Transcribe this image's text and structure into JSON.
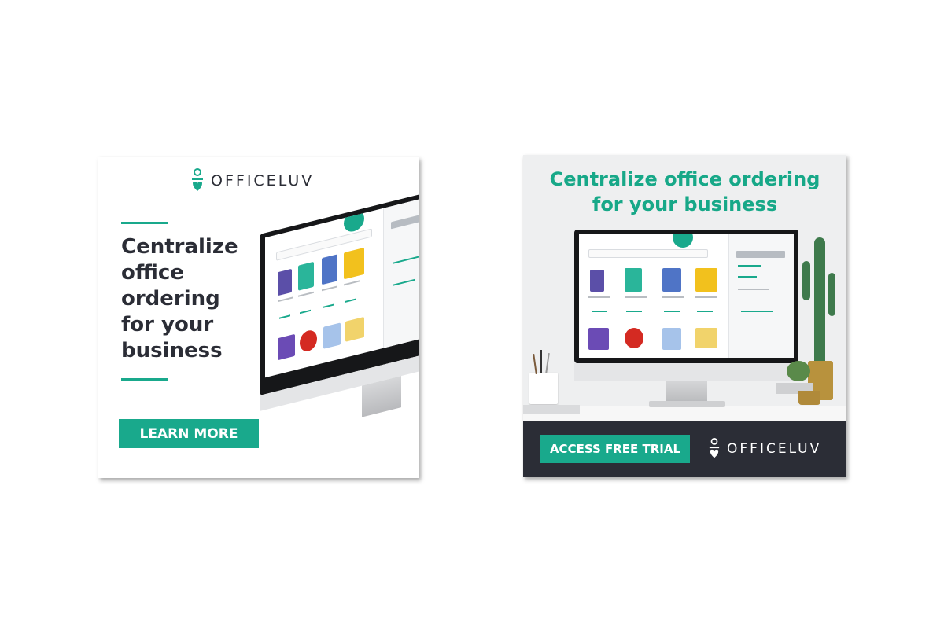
{
  "ad_left": {
    "brand": "OFFICELUV",
    "headline": "Centralize\noffice\nordering\nfor your\nbusiness",
    "button_label": "LEARN MORE"
  },
  "ad_right": {
    "headline": "Centralize office ordering\nfor your business",
    "button_label": "ACCESS FREE TRIAL",
    "brand": "OFFICELUV"
  },
  "colors": {
    "brand_green": "#19a98c",
    "dark_text": "#2b2d36",
    "footer_bar": "#2b2d36"
  },
  "icons": [
    "officeluv-logo-icon",
    "shopping-cart-icon"
  ]
}
